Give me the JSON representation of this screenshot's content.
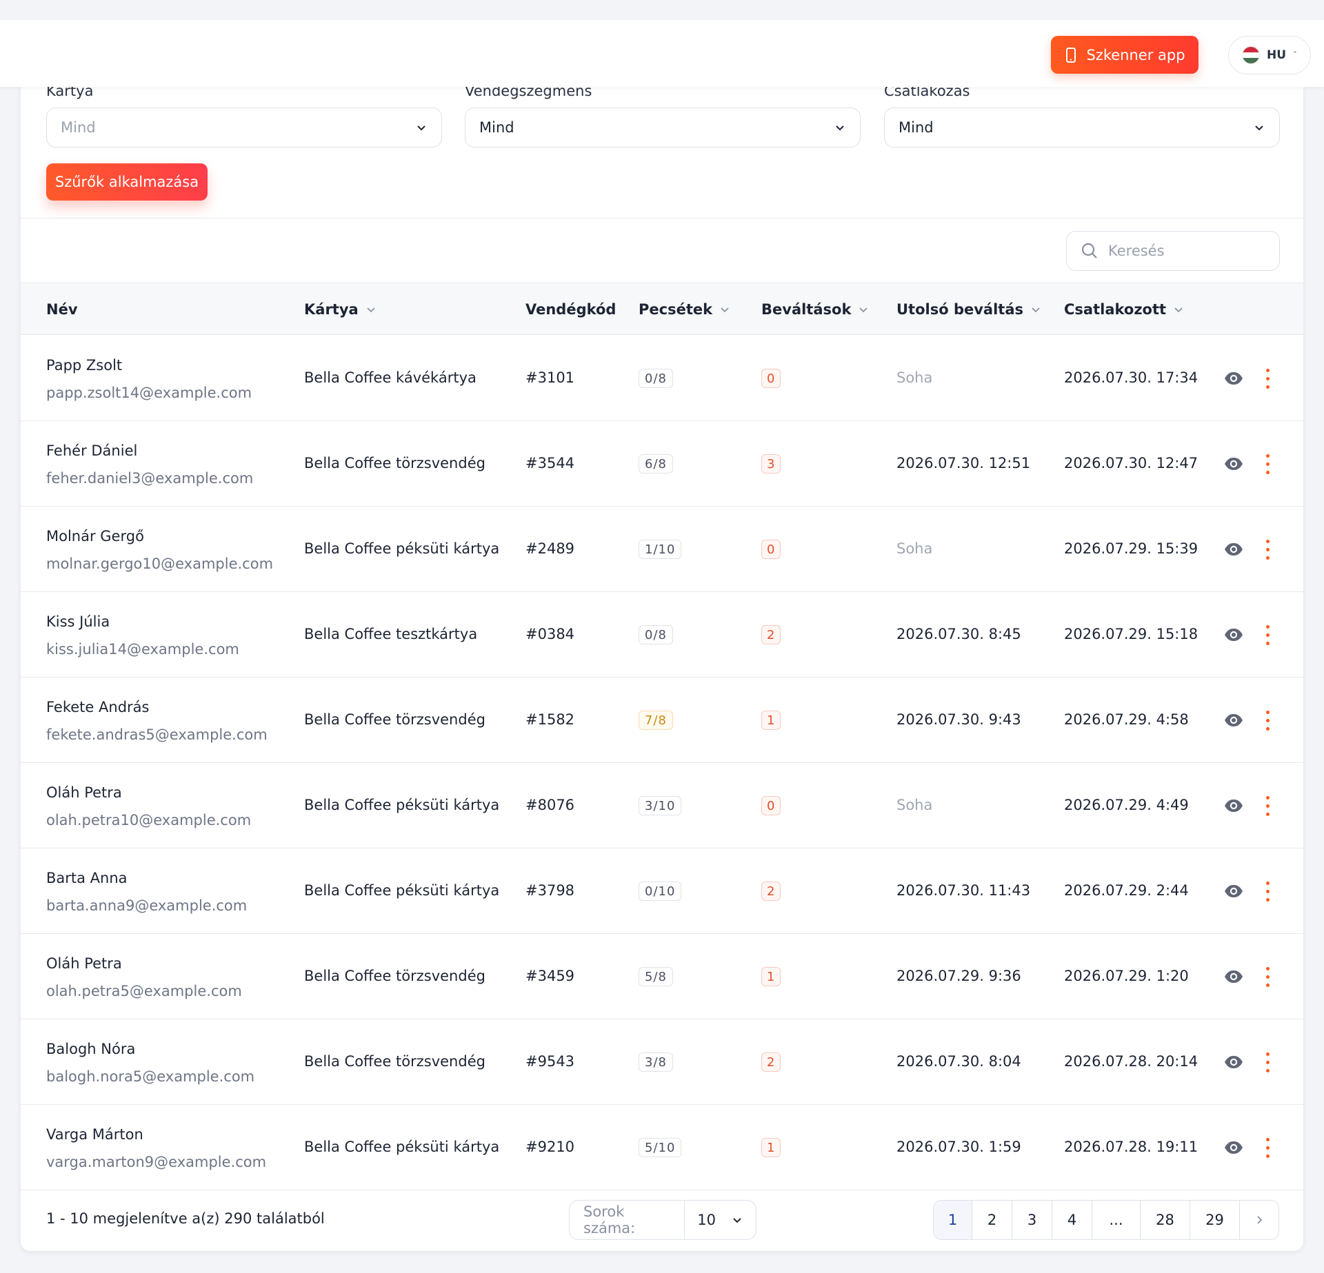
{
  "header": {
    "scanner_label": "Szkenner app",
    "language": "HU",
    "flag_colors": [
      "#ce2939",
      "#ffffff",
      "#477050"
    ]
  },
  "filters": {
    "card": {
      "label": "Kártya",
      "value": "Mind"
    },
    "segment": {
      "label": "Vendégszegmens",
      "value": "Mind"
    },
    "joined": {
      "label": "Csatlakozás",
      "value": "Mind"
    },
    "apply_label": "Szűrők alkalmazása"
  },
  "search": {
    "placeholder": "Keresés"
  },
  "table": {
    "headers": {
      "name": "Név",
      "card": "Kártya",
      "guest_code": "Vendégkód",
      "stamps": "Pecsétek",
      "redemptions": "Beváltások",
      "last_redemption": "Utolsó beváltás",
      "joined": "Csatlakozott"
    },
    "rows": [
      {
        "name": "Papp Zsolt",
        "email": "papp.zsolt14@example.com",
        "card": "Bella Coffee kávékártya",
        "code": "#3101",
        "stamps": "0/8",
        "redemptions": "0",
        "last": "Soha",
        "joined": "2026.07.30. 17:34"
      },
      {
        "name": "Fehér Dániel",
        "email": "feher.daniel3@example.com",
        "card": "Bella Coffee törzsvendég",
        "code": "#3544",
        "stamps": "6/8",
        "redemptions": "3",
        "last": "2026.07.30. 12:51",
        "joined": "2026.07.30. 12:47"
      },
      {
        "name": "Molnár Gergő",
        "email": "molnar.gergo10@example.com",
        "card": "Bella Coffee péksüti kártya",
        "code": "#2489",
        "stamps": "1/10",
        "redemptions": "0",
        "last": "Soha",
        "joined": "2026.07.29. 15:39"
      },
      {
        "name": "Kiss Júlia",
        "email": "kiss.julia14@example.com",
        "card": "Bella Coffee tesztkártya",
        "code": "#0384",
        "stamps": "0/8",
        "redemptions": "2",
        "last": "2026.07.30. 8:45",
        "joined": "2026.07.29. 15:18"
      },
      {
        "name": "Fekete András",
        "email": "fekete.andras5@example.com",
        "card": "Bella Coffee törzsvendég",
        "code": "#1582",
        "stamps": "7/8",
        "redemptions": "1",
        "last": "2026.07.30. 9:43",
        "joined": "2026.07.29. 4:58"
      },
      {
        "name": "Oláh Petra",
        "email": "olah.petra10@example.com",
        "card": "Bella Coffee péksüti kártya",
        "code": "#8076",
        "stamps": "3/10",
        "redemptions": "0",
        "last": "Soha",
        "joined": "2026.07.29. 4:49"
      },
      {
        "name": "Barta Anna",
        "email": "barta.anna9@example.com",
        "card": "Bella Coffee péksüti kártya",
        "code": "#3798",
        "stamps": "0/10",
        "redemptions": "2",
        "last": "2026.07.30. 11:43",
        "joined": "2026.07.29. 2:44"
      },
      {
        "name": "Oláh Petra",
        "email": "olah.petra5@example.com",
        "card": "Bella Coffee törzsvendég",
        "code": "#3459",
        "stamps": "5/8",
        "redemptions": "1",
        "last": "2026.07.29. 9:36",
        "joined": "2026.07.29. 1:20"
      },
      {
        "name": "Balogh Nóra",
        "email": "balogh.nora5@example.com",
        "card": "Bella Coffee törzsvendég",
        "code": "#9543",
        "stamps": "3/8",
        "redemptions": "2",
        "last": "2026.07.30. 8:04",
        "joined": "2026.07.28. 20:14"
      },
      {
        "name": "Varga Márton",
        "email": "varga.marton9@example.com",
        "card": "Bella Coffee péksüti kártya",
        "code": "#9210",
        "stamps": "5/10",
        "redemptions": "1",
        "last": "2026.07.30. 1:59",
        "joined": "2026.07.28. 19:11"
      }
    ]
  },
  "footer": {
    "summary": "1 - 10 megjelenítve a(z) 290 találatból",
    "rows_label": "Sorok száma:",
    "rows_value": "10",
    "pages": [
      "1",
      "2",
      "3",
      "4",
      "...",
      "28",
      "29"
    ],
    "active_page": "1"
  },
  "colors": {
    "accent": "#ff5a1f",
    "badge_warn": "#c98a10",
    "badge_red": "#e0502a"
  }
}
